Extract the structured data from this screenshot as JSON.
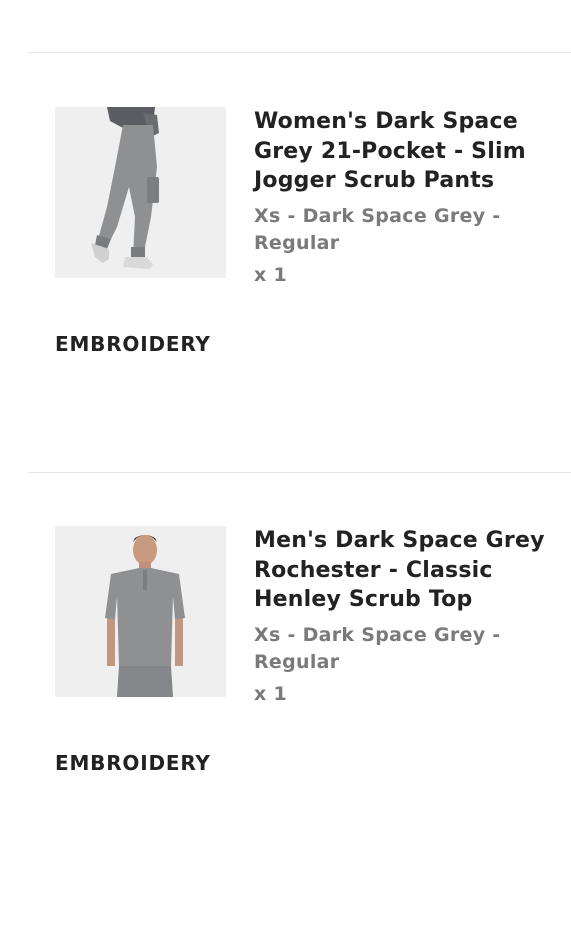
{
  "cart": {
    "items": [
      {
        "title": "Women's Dark Space Grey 21-Pocket - Slim Jogger Scrub Pants",
        "variant": "Xs - Dark Space Grey - Regular",
        "quantity": "x 1",
        "embroidery_label": "EMBROIDERY",
        "image_icon": "scrub-pants-product-photo"
      },
      {
        "title": "Men's Dark Space Grey Rochester - Classic Henley Scrub Top",
        "variant": "Xs - Dark Space Grey - Regular",
        "quantity": "x 1",
        "embroidery_label": "EMBROIDERY",
        "image_icon": "scrub-top-product-photo"
      }
    ]
  },
  "colors": {
    "title": "#222222",
    "secondary_text": "#7a7a7a",
    "divider": "#e6e6e6",
    "image_bg": "#efefef",
    "product_grey": "#8f9092"
  }
}
